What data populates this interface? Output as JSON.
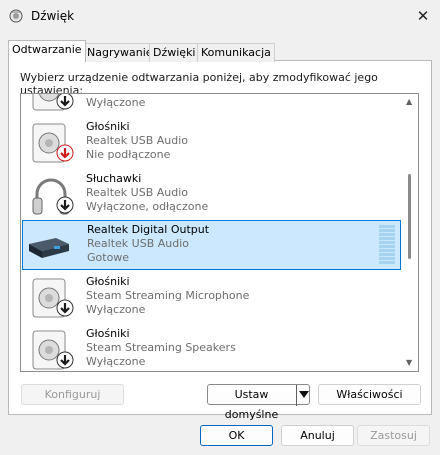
{
  "window": {
    "title": "Dźwięk",
    "close_glyph": "✕"
  },
  "tabs": [
    {
      "label": "Odtwarzanie",
      "active": true
    },
    {
      "label": "Nagrywanie",
      "active": false
    },
    {
      "label": "Dźwięki",
      "active": false
    },
    {
      "label": "Komunikacja",
      "active": false
    }
  ],
  "instruction": "Wybierz urządzenie odtwarzania poniżej, aby zmodyfikować jego ustawienia:",
  "devices": [
    {
      "name": "",
      "line2": "",
      "line3": "Wyłączone",
      "icon": "speaker-icon",
      "status_icon": "down-arrow-icon",
      "selected": false
    },
    {
      "name": "Głośniki",
      "line2": "Realtek USB Audio",
      "line3": "Nie podłączone",
      "icon": "speaker-icon",
      "status_icon": "red-down-arrow-icon",
      "selected": false
    },
    {
      "name": "Słuchawki",
      "line2": "Realtek USB Audio",
      "line3": "Wyłączone, odłączone",
      "icon": "headphones-icon",
      "status_icon": "down-arrow-icon",
      "selected": false
    },
    {
      "name": "Realtek Digital Output",
      "line2": "Realtek USB Audio",
      "line3": "Gotowe",
      "icon": "digital-output-icon",
      "status_icon": "",
      "selected": true
    },
    {
      "name": "Głośniki",
      "line2": "Steam Streaming Microphone",
      "line3": "Wyłączone",
      "icon": "speaker-icon",
      "status_icon": "down-arrow-icon",
      "selected": false
    },
    {
      "name": "Głośniki",
      "line2": "Steam Streaming Speakers",
      "line3": "Wyłączone",
      "icon": "speaker-icon",
      "status_icon": "down-arrow-icon",
      "selected": false
    }
  ],
  "buttons": {
    "configure": "Konfiguruj",
    "set_default": "Ustaw domyślne",
    "properties": "Właściwości",
    "ok": "OK",
    "cancel": "Anuluj",
    "apply": "Zastosuj"
  },
  "colors": {
    "selection_bg": "#cce8ff",
    "selection_border": "#0078d7",
    "vu_meter": "#a6d3ef",
    "disabled_arrow": "#1a1a1a",
    "unplugged_arrow": "#d0191b"
  }
}
